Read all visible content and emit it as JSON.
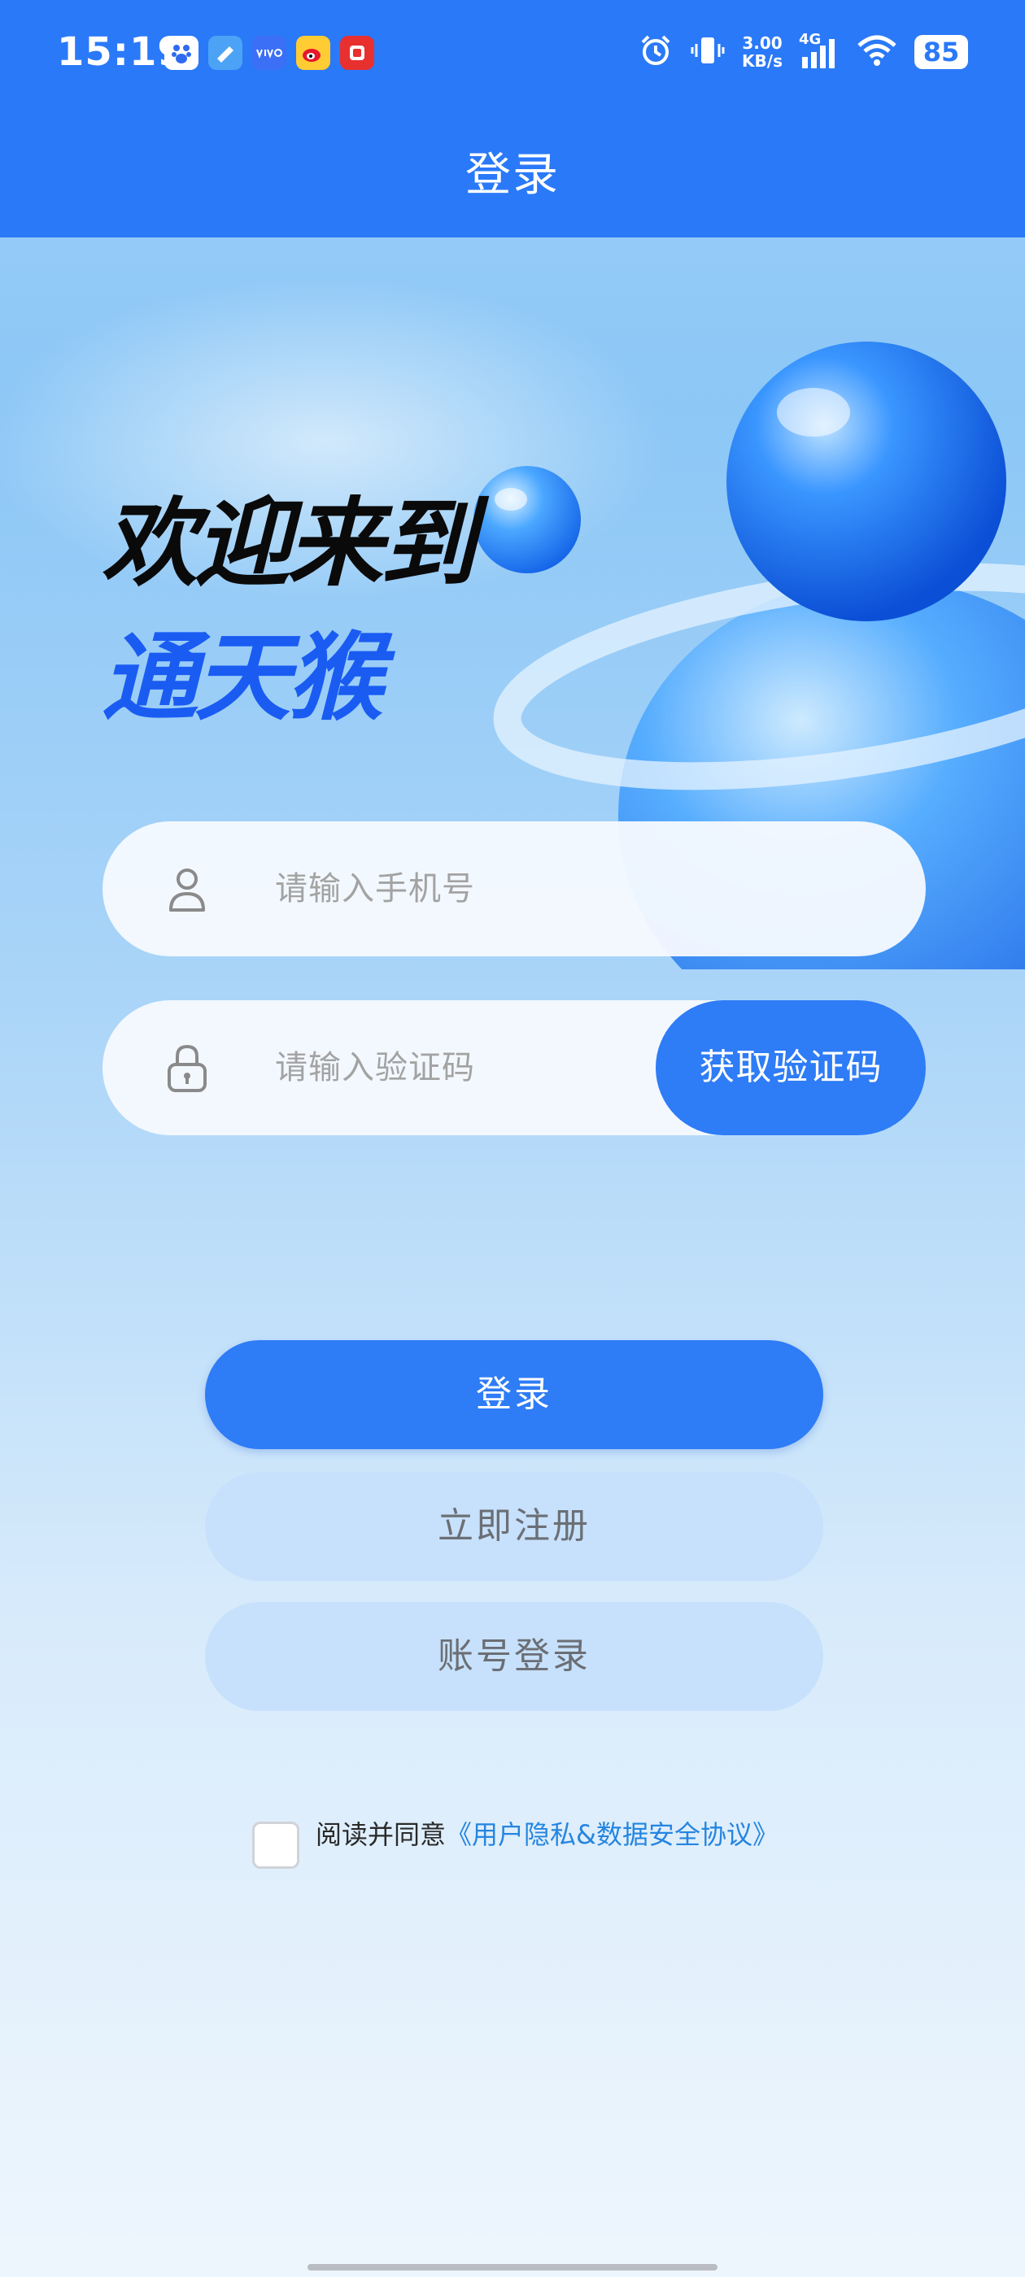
{
  "status_bar": {
    "time": "15:19",
    "net_speed_value": "3.00",
    "net_speed_unit": "KB/s",
    "network": "4G",
    "battery": "85"
  },
  "header": {
    "title": "登录"
  },
  "hero": {
    "welcome_line": "欢迎来到",
    "brand_line": "通天猴"
  },
  "phone_field": {
    "placeholder": "请输入手机号"
  },
  "code_field": {
    "placeholder": "请输入验证码",
    "get_code_label": "获取验证码"
  },
  "buttons": {
    "login": "登录",
    "register": "立即注册",
    "account_login": "账号登录"
  },
  "agreement": {
    "prefix": "阅读并同意",
    "link": "《用户隐私&数据安全协议》",
    "checked": false
  },
  "colors": {
    "primary": "#2e7cf6",
    "header": "#2a79f8",
    "brand": "#1a5cf2",
    "link": "#2585e0"
  }
}
